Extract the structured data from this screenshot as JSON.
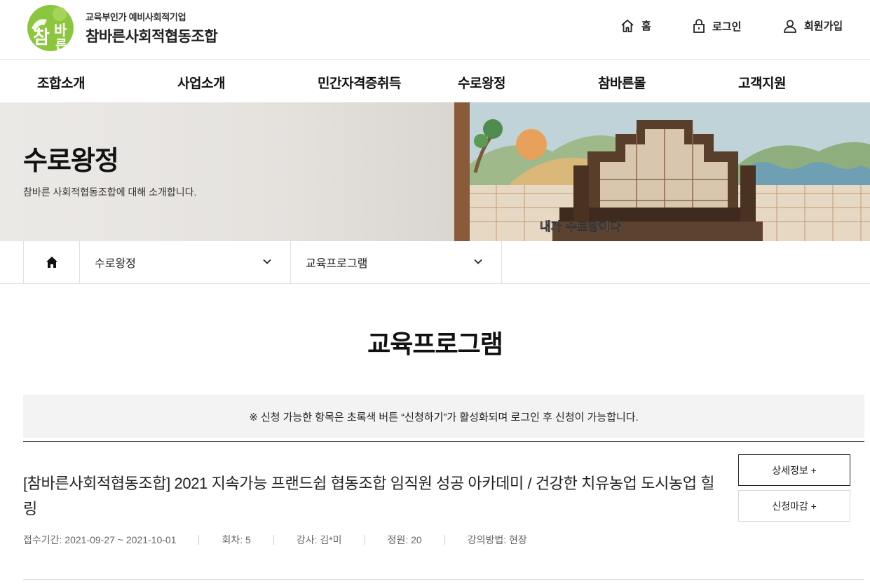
{
  "header": {
    "logo_sub": "교육부인가 예비사회적기업",
    "logo_main": "참바른사회적협동조합",
    "util": [
      {
        "label": "홈",
        "icon": "home-icon"
      },
      {
        "label": "로그인",
        "icon": "lock-icon"
      },
      {
        "label": "회원가입",
        "icon": "user-icon"
      }
    ]
  },
  "gnb": [
    "조합소개",
    "사업소개",
    "민간자격증취득",
    "수로왕정",
    "참바른몰",
    "고객지원"
  ],
  "visual": {
    "title": "수로왕정",
    "desc": "참바른 사회적협동조합에 대해 소개합니다.",
    "photo_caption": "내가 수로왕이다"
  },
  "location": {
    "home_icon": "home-icon",
    "depth1": "수로왕정",
    "depth2": "교육프로그램"
  },
  "page_title": "교육프로그램",
  "notice": "※ 신청 가능한 항목은 초록색 버튼 “신청하기”가 활성화되며 로그인 후 신청이 가능합니다.",
  "items": [
    {
      "title": "[참바른사회적협동조합] 2021 지속가능 프랜드쉽 협동조합 임직원 성공 아카데미 / 건강한 치유농업 도시농업 힐링",
      "detail_button": "상세정보 +",
      "status_button": "신청마감 +",
      "meta": [
        "접수기간: 2021-09-27 ~ 2021-10-01",
        "회차: 5",
        "강사: 김*미",
        "정원: 20",
        "강의방법: 현장"
      ]
    }
  ],
  "colors": {
    "logo_green": "#8bc34a",
    "notice_bg": "#f3f3f3"
  }
}
